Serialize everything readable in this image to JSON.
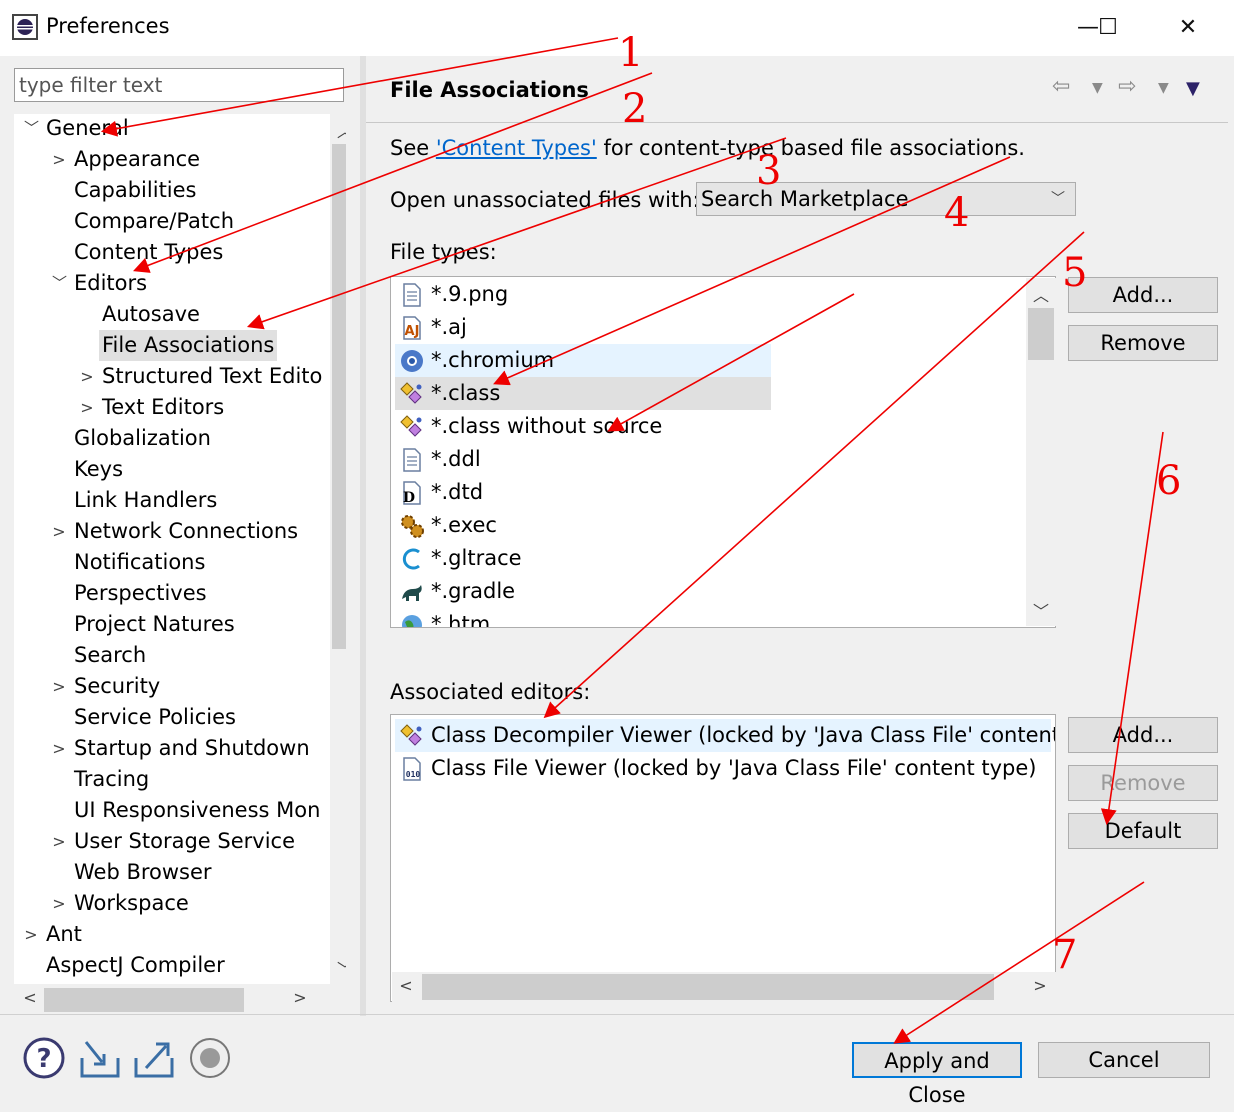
{
  "window": {
    "title": "Preferences"
  },
  "filter": {
    "placeholder": "type filter text"
  },
  "tree": [
    {
      "label": "General",
      "level": 0,
      "arrow": "open",
      "selected": false
    },
    {
      "label": "Appearance",
      "level": 1,
      "arrow": "closed",
      "selected": false
    },
    {
      "label": "Capabilities",
      "level": 1,
      "arrow": "none",
      "selected": false
    },
    {
      "label": "Compare/Patch",
      "level": 1,
      "arrow": "none",
      "selected": false
    },
    {
      "label": "Content Types",
      "level": 1,
      "arrow": "none",
      "selected": false
    },
    {
      "label": "Editors",
      "level": 1,
      "arrow": "open",
      "selected": false
    },
    {
      "label": "Autosave",
      "level": 2,
      "arrow": "none",
      "selected": false
    },
    {
      "label": "File Associations",
      "level": 2,
      "arrow": "none",
      "selected": true
    },
    {
      "label": "Structured Text Edito",
      "level": 2,
      "arrow": "closed",
      "selected": false
    },
    {
      "label": "Text Editors",
      "level": 2,
      "arrow": "closed",
      "selected": false
    },
    {
      "label": "Globalization",
      "level": 1,
      "arrow": "none",
      "selected": false
    },
    {
      "label": "Keys",
      "level": 1,
      "arrow": "none",
      "selected": false
    },
    {
      "label": "Link Handlers",
      "level": 1,
      "arrow": "none",
      "selected": false
    },
    {
      "label": "Network Connections",
      "level": 1,
      "arrow": "closed",
      "selected": false
    },
    {
      "label": "Notifications",
      "level": 1,
      "arrow": "none",
      "selected": false
    },
    {
      "label": "Perspectives",
      "level": 1,
      "arrow": "none",
      "selected": false
    },
    {
      "label": "Project Natures",
      "level": 1,
      "arrow": "none",
      "selected": false
    },
    {
      "label": "Search",
      "level": 1,
      "arrow": "none",
      "selected": false
    },
    {
      "label": "Security",
      "level": 1,
      "arrow": "closed",
      "selected": false
    },
    {
      "label": "Service Policies",
      "level": 1,
      "arrow": "none",
      "selected": false
    },
    {
      "label": "Startup and Shutdown",
      "level": 1,
      "arrow": "closed",
      "selected": false
    },
    {
      "label": "Tracing",
      "level": 1,
      "arrow": "none",
      "selected": false
    },
    {
      "label": "UI Responsiveness Mon",
      "level": 1,
      "arrow": "none",
      "selected": false
    },
    {
      "label": "User Storage Service",
      "level": 1,
      "arrow": "closed",
      "selected": false
    },
    {
      "label": "Web Browser",
      "level": 1,
      "arrow": "none",
      "selected": false
    },
    {
      "label": "Workspace",
      "level": 1,
      "arrow": "closed",
      "selected": false
    },
    {
      "label": "Ant",
      "level": 0,
      "arrow": "closed",
      "selected": false
    },
    {
      "label": "AspectJ Compiler",
      "level": 0,
      "arrow": "none",
      "selected": false
    }
  ],
  "page": {
    "title": "File Associations",
    "see_prefix": "See ",
    "see_link": "'Content Types'",
    "see_suffix": " for content-type based file associations.",
    "open_label": "Open unassociated files with:",
    "open_value": "Search Marketplace",
    "file_types_label": "File types:",
    "file_types": [
      {
        "label": "*.9.png",
        "icon": "text-file-icon",
        "highlight": "none"
      },
      {
        "label": "*.aj",
        "icon": "aspectj-file-icon",
        "highlight": "none"
      },
      {
        "label": "*.chromium",
        "icon": "chromium-icon",
        "highlight": "hover"
      },
      {
        "label": "*.class",
        "icon": "class-file-icon",
        "highlight": "selected"
      },
      {
        "label": "*.class without source",
        "icon": "class-file-icon",
        "highlight": "none"
      },
      {
        "label": "*.ddl",
        "icon": "text-file-icon",
        "highlight": "none"
      },
      {
        "label": "*.dtd",
        "icon": "dtd-file-icon",
        "highlight": "none"
      },
      {
        "label": "*.exec",
        "icon": "gears-icon",
        "highlight": "none"
      },
      {
        "label": "*.gltrace",
        "icon": "gltrace-icon",
        "highlight": "none"
      },
      {
        "label": "*.gradle",
        "icon": "gradle-icon",
        "highlight": "none"
      },
      {
        "label": "*.htm",
        "icon": "globe-icon",
        "highlight": "none"
      }
    ],
    "ft_add": "Add...",
    "ft_remove": "Remove",
    "assoc_label": "Associated editors:",
    "assoc_editors": [
      {
        "label": "Class Decompiler Viewer (locked by 'Java Class File' content ty",
        "icon": "class-file-icon",
        "highlight": "hover"
      },
      {
        "label": "Class File Viewer (locked by 'Java Class File' content type)",
        "icon": "binary-file-icon",
        "highlight": "none"
      }
    ],
    "ae_add": "Add...",
    "ae_remove": "Remove",
    "ae_default": "Default"
  },
  "footer": {
    "apply_close": "Apply and Close",
    "cancel": "Cancel"
  },
  "annotations": [
    "1",
    "2",
    "3",
    "4",
    "5",
    "6",
    "7"
  ],
  "colors": {
    "annotation": "#e00000",
    "selection": "#e0e0e0",
    "hover": "#e5f3ff",
    "link": "#0066cc",
    "focus": "#0078d7"
  }
}
